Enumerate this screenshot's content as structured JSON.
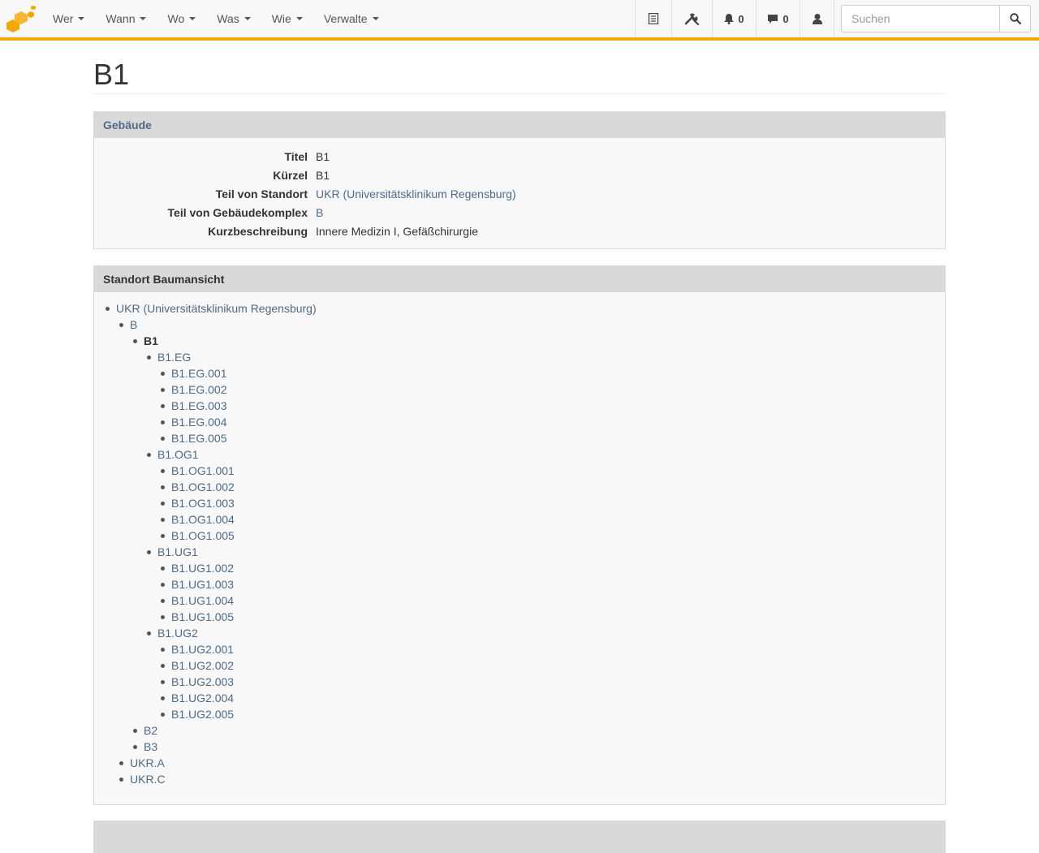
{
  "navbar": {
    "menu": [
      {
        "label": "Wer"
      },
      {
        "label": "Wann"
      },
      {
        "label": "Wo"
      },
      {
        "label": "Was"
      },
      {
        "label": "Wie"
      },
      {
        "label": "Verwalte"
      }
    ],
    "notifications_count": "0",
    "messages_count": "0",
    "search_placeholder": "Suchen",
    "icons": [
      "list-icon",
      "wrench-icon",
      "bell-icon",
      "comment-icon",
      "user-icon",
      "search-icon"
    ],
    "accent_color": "#f5a800"
  },
  "page": {
    "title": "B1"
  },
  "building_panel": {
    "heading": "Gebäude",
    "fields": [
      {
        "label": "Titel",
        "value": "B1"
      },
      {
        "label": "Kürzel",
        "value": "B1"
      },
      {
        "label": "Teil von Standort",
        "value": "UKR (Universitätsklinikum Regensburg)"
      },
      {
        "label": "Teil von Gebäudekomplex",
        "value": "B"
      },
      {
        "label": "Kurzbeschreibung",
        "value": "Innere Medizin I, Gefäßchirurgie"
      }
    ]
  },
  "tree_panel": {
    "heading": "Standort Baumansicht",
    "nodes": {
      "root": "UKR (Universitätsklinikum Regensburg)",
      "b": "B",
      "b1": "B1",
      "eg": "B1.EG",
      "eg_rooms": [
        "B1.EG.001",
        "B1.EG.002",
        "B1.EG.003",
        "B1.EG.004",
        "B1.EG.005"
      ],
      "og1": "B1.OG1",
      "og1_rooms": [
        "B1.OG1.001",
        "B1.OG1.002",
        "B1.OG1.003",
        "B1.OG1.004",
        "B1.OG1.005"
      ],
      "ug1": "B1.UG1",
      "ug1_rooms": [
        "B1.UG1.002",
        "B1.UG1.003",
        "B1.UG1.004",
        "B1.UG1.005"
      ],
      "ug2": "B1.UG2",
      "ug2_rooms": [
        "B1.UG2.001",
        "B1.UG2.002",
        "B1.UG2.003",
        "B1.UG2.004",
        "B1.UG2.005"
      ],
      "b2": "B2",
      "b3": "B3",
      "ukr_a": "UKR.A",
      "ukr_c": "UKR.C"
    }
  }
}
